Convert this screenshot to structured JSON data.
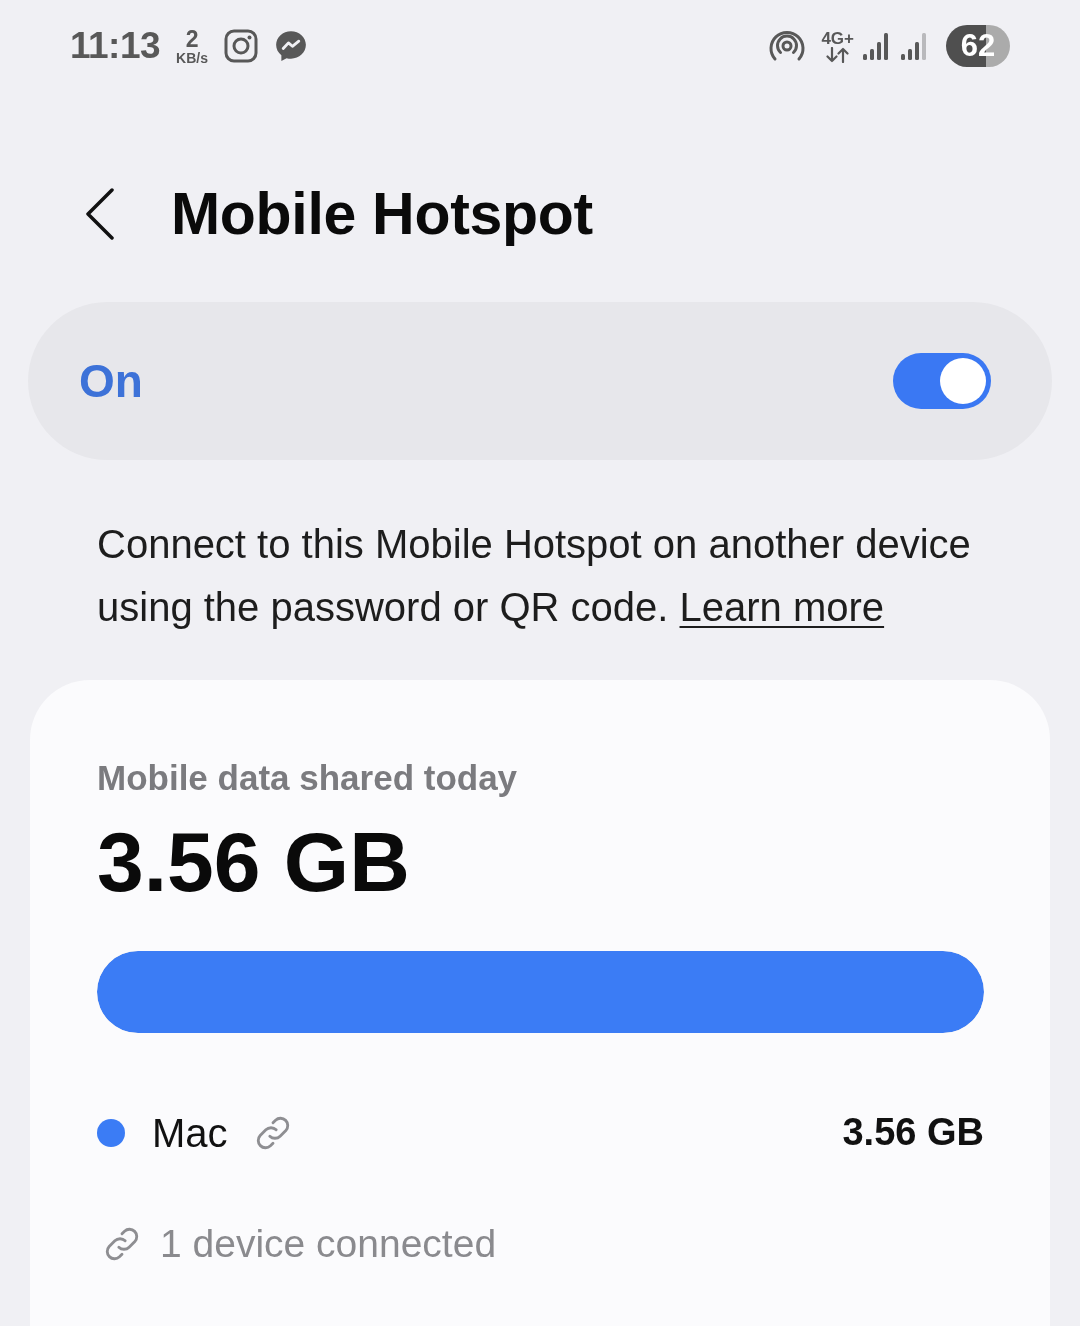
{
  "status_bar": {
    "time": "11:13",
    "net_speed": {
      "value": "2",
      "unit": "KB/s"
    },
    "network_type": "4G+",
    "battery": "62"
  },
  "header": {
    "title": "Mobile Hotspot"
  },
  "master_switch": {
    "label": "On",
    "on": true
  },
  "description": {
    "text": "Connect to this Mobile Hotspot on another device using the password or QR code.",
    "link": "Learn more"
  },
  "usage_card": {
    "label": "Mobile data shared today",
    "total": "3.56 GB",
    "usage_bar": {
      "level": 1
    },
    "devices": [
      {
        "name": "Mac",
        "color": "#3b7cf5",
        "usage": "3.56 GB"
      }
    ],
    "footer": "1 device connected"
  }
}
